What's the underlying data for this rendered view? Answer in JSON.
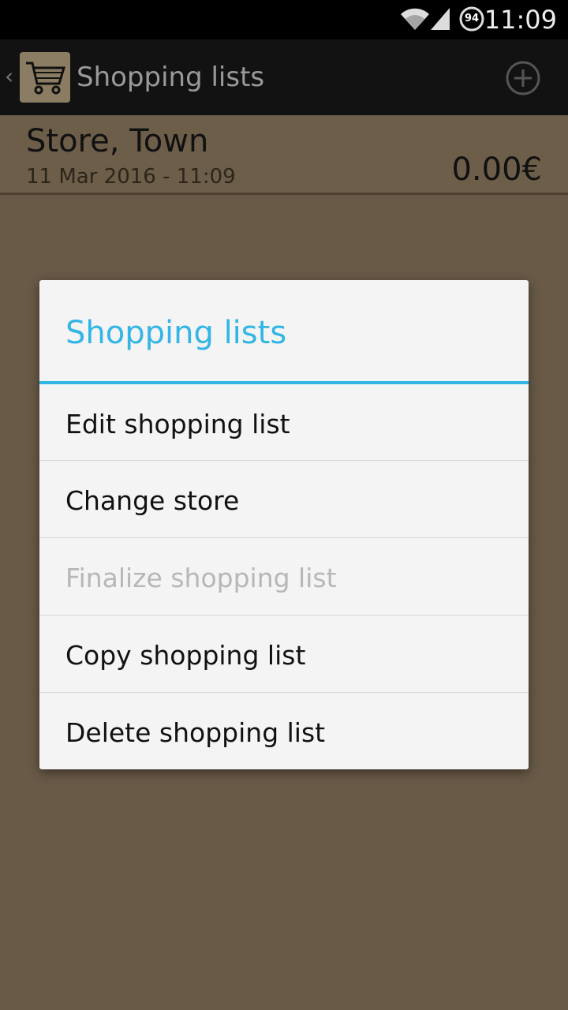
{
  "status_bar": {
    "time": "11:09",
    "battery_level": "94",
    "icons": [
      "wifi-icon",
      "signal-icon",
      "battery-icon"
    ]
  },
  "action_bar": {
    "title": "Shopping lists",
    "icons": [
      "back-icon",
      "shopping-cart-icon",
      "add-icon"
    ]
  },
  "list": {
    "items": [
      {
        "store": "Store, Town",
        "date": "11 Mar 2016 - 11:09",
        "total": "0.00€"
      }
    ]
  },
  "dialog": {
    "title": "Shopping lists",
    "accent_color": "#33b5e5",
    "items": [
      {
        "label": "Edit shopping list",
        "enabled": true
      },
      {
        "label": "Change store",
        "enabled": true
      },
      {
        "label": "Finalize shopping list",
        "enabled": false
      },
      {
        "label": "Copy shopping list",
        "enabled": true
      },
      {
        "label": "Delete shopping list",
        "enabled": true
      }
    ]
  }
}
